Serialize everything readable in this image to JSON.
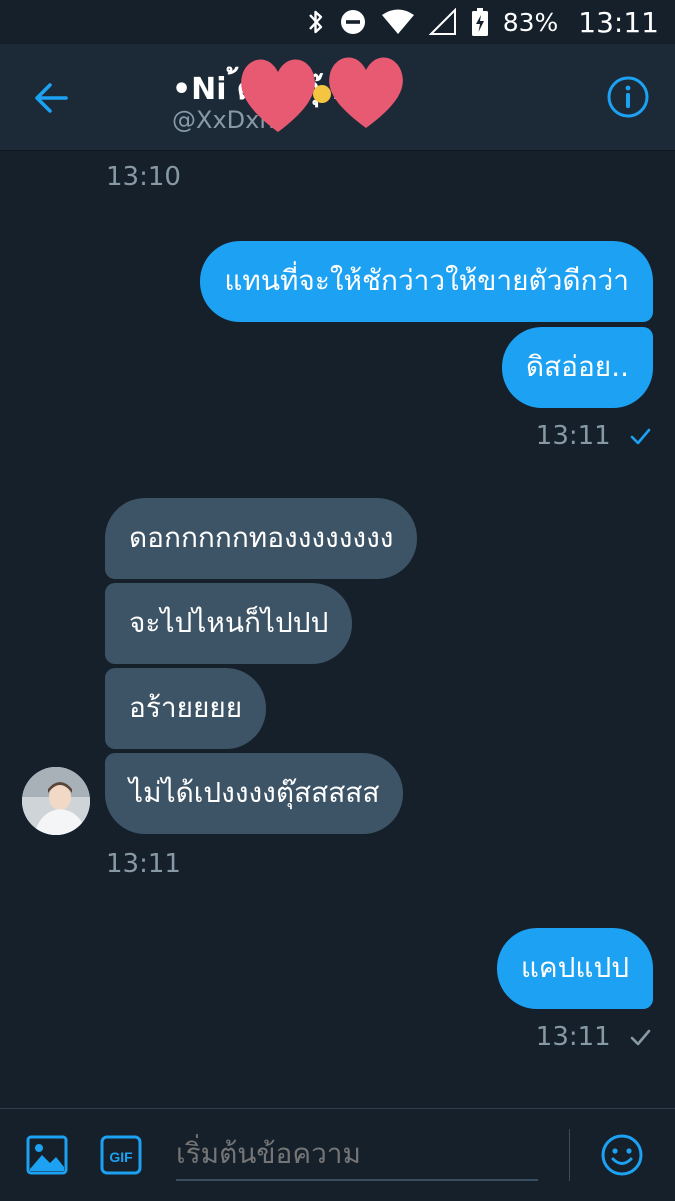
{
  "status_bar": {
    "battery": "83%",
    "time": "13:11",
    "icons": [
      "bluetooth-icon",
      "do-not-disturb-icon",
      "wifi-icon",
      "cell-signal-icon",
      "battery-charging-icon"
    ]
  },
  "header": {
    "title": "•Ni   ้ด้เปงตุ๊...",
    "handle": "@XxDxn",
    "back_icon": "back-arrow-icon",
    "info_icon": "info-icon",
    "accent": "#1da1f2"
  },
  "messages": [
    {
      "group": "time",
      "text": "13:10"
    },
    {
      "group": "sent",
      "text": "แทนที่จะให้ชักว่าวให้ขายตัวดีกว่า"
    },
    {
      "group": "sent",
      "text": "ดิสอ่อย.."
    },
    {
      "group": "time-sent",
      "text": "13:11"
    },
    {
      "group": "recv",
      "text": "ดอกกกกกทองงงงงงงง"
    },
    {
      "group": "recv",
      "text": "จะไปไหนก็ไปปป"
    },
    {
      "group": "recv",
      "text": "อร้ายยยย"
    },
    {
      "group": "recv",
      "text": "ไม่ได้เปงงงงตุ๊สสสสส"
    },
    {
      "group": "time",
      "text": "13:11"
    },
    {
      "group": "sent",
      "text": "แคปแปป"
    },
    {
      "group": "time-sent",
      "text": "13:11"
    }
  ],
  "composer": {
    "placeholder": "เริ่มต้นข้อความ",
    "gif_label": "GIF",
    "icons": [
      "image-icon",
      "gif-icon",
      "emoji-icon"
    ]
  },
  "colors": {
    "background": "#15202b",
    "header": "#1c2a38",
    "sent_bubble": "#1da1f2",
    "received_bubble": "#3d5466",
    "muted_text": "#8899a6"
  }
}
